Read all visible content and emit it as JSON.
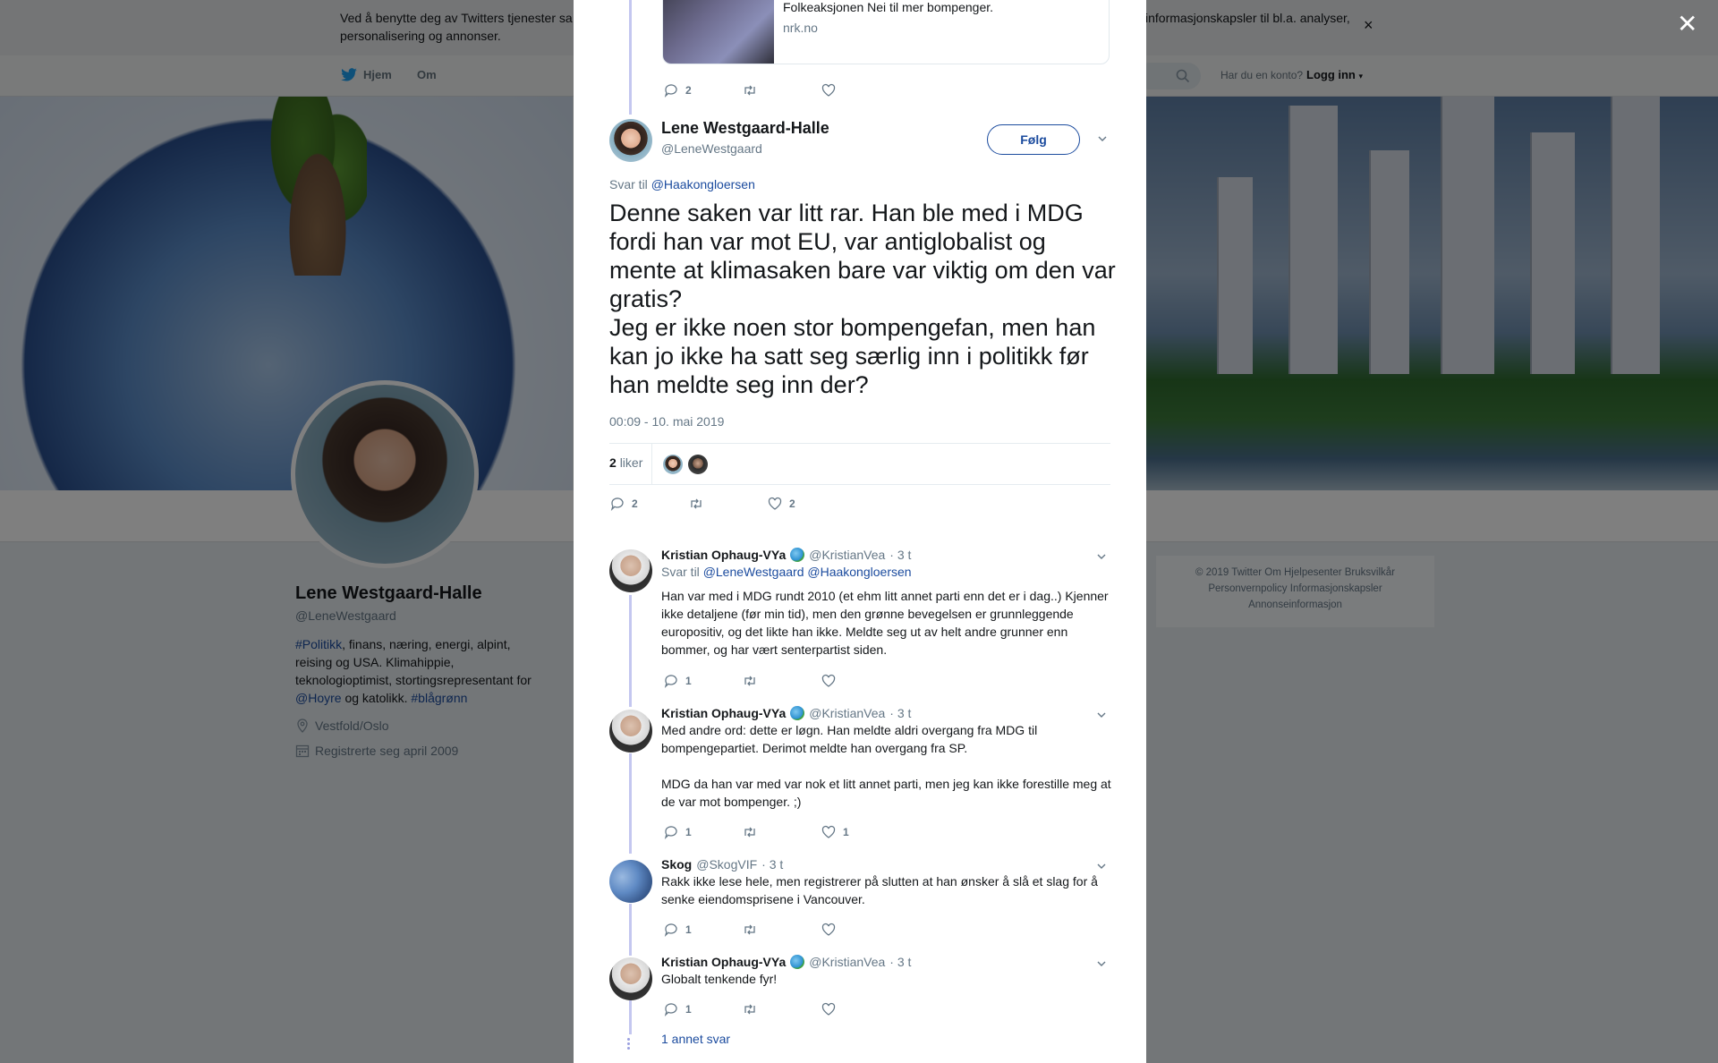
{
  "cookie_bar": {
    "text_line1": "Ved å benytte deg av Twitters tjenester sa",
    "text_line1_right": "informasjonskapsler til bl.a. analyser,",
    "text_line2": "personalisering og annonser.",
    "close": "×"
  },
  "topnav": {
    "home": "Hjem",
    "about": "Om",
    "login_prompt": "Har du en konto?",
    "login": "Logg inn"
  },
  "profile": {
    "name": "Lene Westgaard-Halle",
    "handle": "@LeneWestgaard",
    "bio_tag1": "#Politikk",
    "bio_text1": ", finans, næring, energi, alpint, reising og USA. Klimahippie, teknologioptimist, stortingsrepresentant for ",
    "bio_tag2": "@Hoyre",
    "bio_text2": " og katolikk. ",
    "bio_tag3": "#blågrønn",
    "location": "Vestfold/Oslo",
    "joined": "Registrerte seg april 2009"
  },
  "footer": {
    "line1": "© 2019 Twitter   Om   Hjelpesenter   Bruksvilkår",
    "line2": "Personvernpolicy   Informasjonskapsler",
    "line3": "Annonseinformasjon"
  },
  "overlay": {
    "close": "✕"
  },
  "card": {
    "title": "Folkeaksjonen Nei til mer bompenger.",
    "domain": "nrk.no",
    "replies": "2"
  },
  "main_tweet": {
    "name": "Lene Westgaard-Halle",
    "handle": "@LeneWestgaard",
    "follow": "Følg",
    "reply_to_label": "Svar til",
    "reply_to_handle": "@Haakongloersen",
    "text_p1": "Denne saken var litt rar. Han ble med i MDG fordi han var mot EU, var antiglobalist og mente at klimasaken bare var viktig om den var gratis?",
    "text_p2": "Jeg er ikke noen stor bompengefan, men han kan jo ikke ha satt seg særlig inn i politikk før han meldte seg inn der?",
    "timestamp": "00:09 - 10. mai 2019",
    "likes_count": "2",
    "likes_label": "liker",
    "replies": "2",
    "like_count": "2"
  },
  "replies": [
    {
      "name": "Kristian Ophaug-VYa",
      "handle": "@KristianVea",
      "time": "· 3 t",
      "reply_to_label": "Svar til",
      "reply_to": "@LeneWestgaard @Haakongloersen",
      "text": "Han var med i MDG rundt 2010 (et ehm litt annet parti enn det er i dag..) Kjenner ikke detaljene (før min tid), men den grønne bevegelsen er grunnleggende europositiv, og det likte han ikke. Meldte seg ut av helt andre grunner enn bommer, og har vært senterpartist siden.",
      "replies": "1",
      "likes": ""
    },
    {
      "name": "Kristian Ophaug-VYa",
      "handle": "@KristianVea",
      "time": "· 3 t",
      "text_p1": "Med andre ord: dette er løgn. Han meldte aldri overgang fra MDG til bompengepartiet. Derimot meldte han overgang fra SP.",
      "text_p2": "MDG da han var med var nok et litt annet parti, men jeg kan ikke forestille meg at de var mot bompenger. ;)",
      "replies": "1",
      "likes": "1"
    },
    {
      "name": "Skog",
      "handle": "@SkogVIF",
      "time": "· 3 t",
      "text": "Rakk ikke lese hele, men registrerer på slutten at han ønsker å slå et slag for å senke eiendomsprisene i Vancouver.",
      "replies": "1",
      "likes": ""
    },
    {
      "name": "Kristian Ophaug-VYa",
      "handle": "@KristianVea",
      "time": "· 3 t",
      "text": "Globalt tenkende fyr!",
      "replies": "1",
      "likes": ""
    }
  ],
  "more_replies": "1 annet svar",
  "colors": {
    "link": "#1b4b9e",
    "thread": "#c4c7f0",
    "overlay": "rgba(0,0,0,0.5)"
  }
}
